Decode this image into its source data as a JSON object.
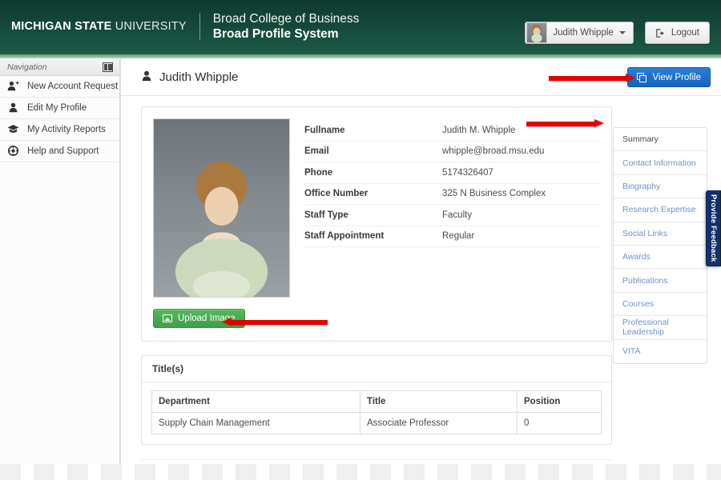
{
  "header": {
    "msu_bold": "MICHIGAN STATE",
    "msu_light": " UNIVERSITY",
    "college_line1": "Broad College of Business",
    "college_line2": "Broad Profile System",
    "user_name": "Judith Whipple",
    "logout_label": "Logout",
    "avatar_icon": "user-avatar-photo",
    "logout_icon": "sign-out-icon",
    "caret_icon": "chevron-down-icon"
  },
  "sidebar": {
    "title": "Navigation",
    "collapse_icon": "panel-collapse-icon",
    "items": [
      {
        "label": "New Account Request",
        "icon": "user-plus-icon",
        "glyph": "\u0000"
      },
      {
        "label": "Edit My Profile",
        "icon": "user-icon",
        "glyph": "\u0000"
      },
      {
        "label": "My Activity Reports",
        "icon": "graduation-cap-icon",
        "glyph": "\u0000"
      },
      {
        "label": "Help and Support",
        "icon": "life-ring-icon",
        "glyph": "\u0000"
      }
    ]
  },
  "page": {
    "title": "Judith Whipple",
    "title_icon": "user-icon",
    "view_profile_label": "View Profile",
    "view_profile_icon": "copy-window-icon"
  },
  "profile": {
    "photo_alt": "profile-photo",
    "fields": [
      {
        "key": "Fullname",
        "value": "Judith M. Whipple"
      },
      {
        "key": "Email",
        "value": "whipple@broad.msu.edu"
      },
      {
        "key": "Phone",
        "value": "5174326407"
      },
      {
        "key": "Office Number",
        "value": "325 N Business Complex"
      },
      {
        "key": "Staff Type",
        "value": "Faculty"
      },
      {
        "key": "Staff Appointment",
        "value": "Regular"
      }
    ],
    "upload_label": "Upload Image",
    "upload_icon": "image-icon"
  },
  "titles": {
    "heading": "Title(s)",
    "columns": [
      "Department",
      "Title",
      "Position"
    ],
    "rows": [
      [
        "Supply Chain Management",
        "Associate Professor",
        "0"
      ]
    ]
  },
  "tabs": [
    {
      "label": "Summary",
      "active": true
    },
    {
      "label": "Contact Information",
      "active": false
    },
    {
      "label": "Biography",
      "active": false
    },
    {
      "label": "Research Expertise",
      "active": false
    },
    {
      "label": "Social Links",
      "active": false
    },
    {
      "label": "Awards",
      "active": false
    },
    {
      "label": "Publications",
      "active": false
    },
    {
      "label": "Courses",
      "active": false
    },
    {
      "label": "Professional Leadership",
      "active": false
    },
    {
      "label": "VITA",
      "active": false
    }
  ],
  "feedback": {
    "label": "Provide Feedback"
  },
  "annotations": {
    "arrow_view_profile": "red-arrow-pointing-to-view-profile",
    "arrow_summary": "red-arrow-pointing-to-summary-tab",
    "arrow_upload": "red-arrow-pointing-to-upload-image"
  },
  "colors": {
    "msu_green": "#14483a",
    "accent_green": "#6d9b7e",
    "primary_blue": "#1565c0",
    "success_green": "#3f9f49",
    "feedback_navy": "#12306b",
    "annotation_red": "#e30000",
    "tab_link_blue": "#6d93c6"
  }
}
